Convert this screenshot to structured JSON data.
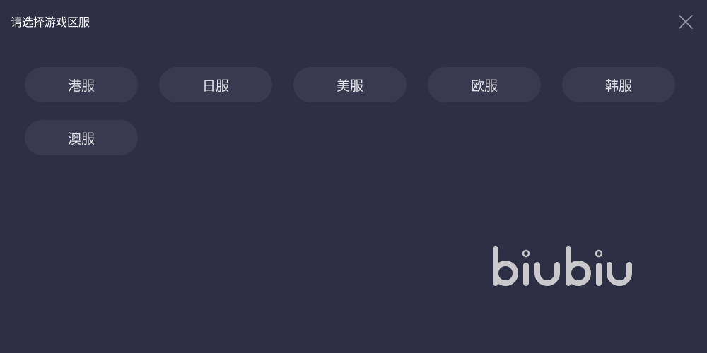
{
  "dialog": {
    "title": "请选择游戏区服"
  },
  "icons": {
    "close": "close-icon",
    "logo": "biubiu-logo"
  },
  "colors": {
    "background": "#2d3044",
    "button_background": "#383b50",
    "button_text": "#e6e6ec",
    "logo": "#c9c9cc"
  },
  "regions": [
    {
      "label": "港服"
    },
    {
      "label": "日服"
    },
    {
      "label": "美服"
    },
    {
      "label": "欧服"
    },
    {
      "label": "韩服"
    },
    {
      "label": "澳服"
    }
  ],
  "brand": {
    "wordmark": "biubiu"
  }
}
